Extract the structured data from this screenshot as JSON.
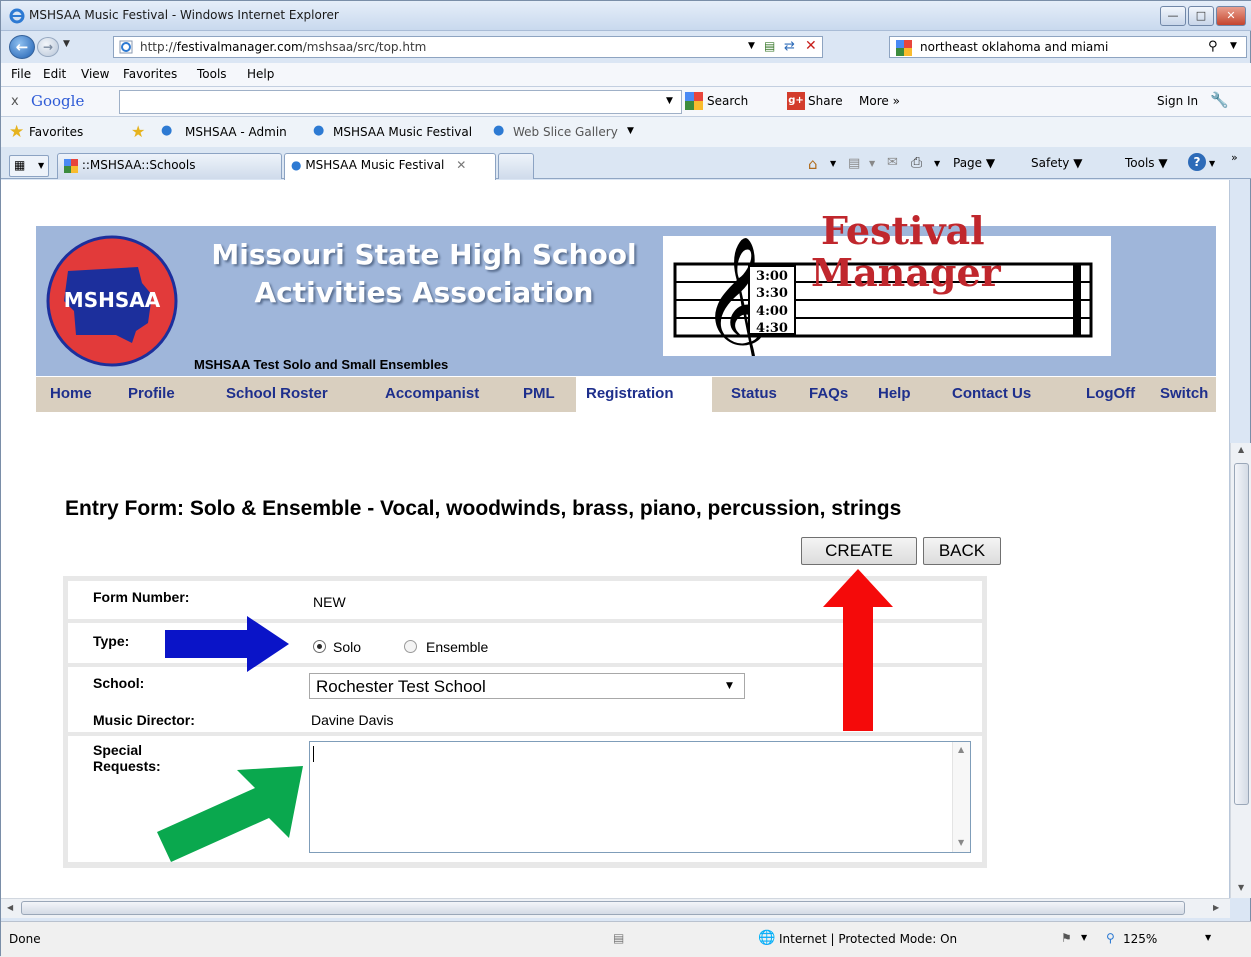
{
  "window": {
    "title": "MSHSAA Music Festival - Windows Internet Explorer"
  },
  "address": {
    "url_prefix": "http://",
    "url_domain": "festivalmanager.com",
    "url_path": "/mshsaa/src/top.htm",
    "search_value": "northeast oklahoma and miami"
  },
  "menu": [
    "File",
    "Edit",
    "View",
    "Favorites",
    "Tools",
    "Help"
  ],
  "google_bar": {
    "close": "x",
    "logo": "Google",
    "search_label": "Search",
    "share_label": "Share",
    "more_label": "More »",
    "signin_label": "Sign In"
  },
  "favorites": {
    "label": "Favorites",
    "links": [
      "MSHSAA - Admin",
      "MSHSAA Music Festival",
      "Web Slice Gallery"
    ]
  },
  "tabs": [
    {
      "label": "::MSHSAA::Schools"
    },
    {
      "label": "MSHSAA Music Festival"
    }
  ],
  "command_bar": {
    "page": "Page",
    "safety": "Safety",
    "tools": "Tools"
  },
  "banner": {
    "logo_text": "MSHSAA",
    "title_line1": "Missouri State High School",
    "title_line2": "Activities Association",
    "times": [
      "3:00",
      "3:30",
      "4:00",
      "4:30"
    ],
    "festival_line1": "Festival",
    "festival_line2": "Manager",
    "subtitle": "MSHSAA Test Solo and Small Ensembles"
  },
  "nav": [
    "Home",
    "Profile",
    "School Roster",
    "Accompanist",
    "PML",
    "Registration",
    "Status",
    "FAQs",
    "Help",
    "Contact Us",
    "LogOff",
    "Switch"
  ],
  "nav_active": "Registration",
  "page": {
    "heading": "Entry Form: Solo & Ensemble - Vocal, woodwinds, brass, piano, percussion, strings",
    "create_label": "CREATE",
    "back_label": "BACK"
  },
  "form": {
    "form_number_label": "Form Number:",
    "form_number_value": "NEW",
    "type_label": "Type:",
    "type_options": [
      "Solo",
      "Ensemble"
    ],
    "type_selected": "Solo",
    "school_label": "School:",
    "school_value": "Rochester Test School",
    "director_label": "Music Director:",
    "director_value": "Davine Davis",
    "requests_label_line1": "Special",
    "requests_label_line2": "Requests:",
    "requests_value": ""
  },
  "status": {
    "left": "Done",
    "zone": "Internet | Protected Mode: On",
    "zoom": "125%"
  },
  "colors": {
    "banner_blue": "#9fb6da",
    "nav_tan": "#d9cfbf",
    "nav_link": "#1e2f8c",
    "arrow_blue": "#0a14c8",
    "arrow_red": "#f50a0a",
    "arrow_green": "#0aa84e",
    "festival_red": "#c0272d"
  }
}
